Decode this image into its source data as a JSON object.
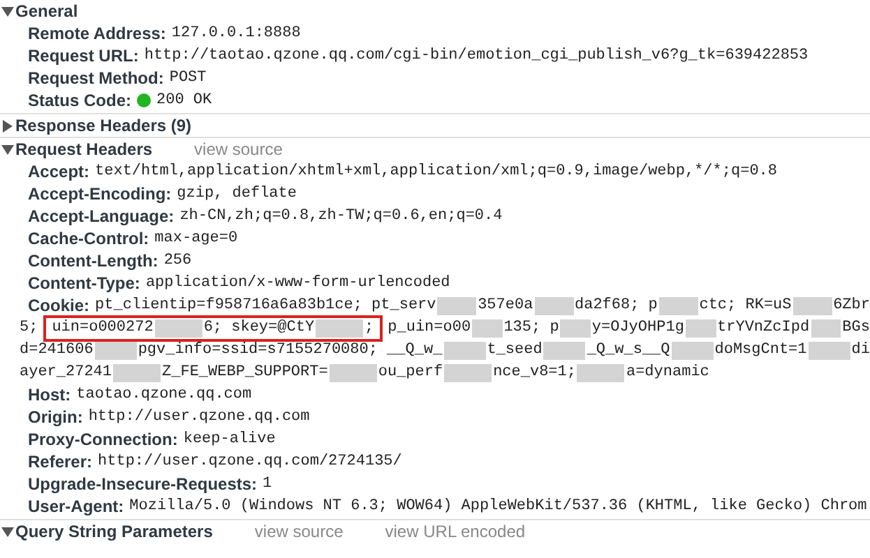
{
  "sections": [
    {
      "title": "General",
      "expanded": true,
      "rows": [
        {
          "kind": "field",
          "name": "Remote Address:",
          "value": "127.0.0.1:8888"
        },
        {
          "kind": "field",
          "name": "Request URL:",
          "value": "http://taotao.qzone.qq.com/cgi-bin/emotion_cgi_publish_v6?g_tk=639422853"
        },
        {
          "kind": "field",
          "name": "Request Method:",
          "value": "POST"
        },
        {
          "kind": "status",
          "name": "Status Code:",
          "value": "200 OK"
        }
      ]
    },
    {
      "title": "Response Headers (9)",
      "expanded": false
    },
    {
      "title": "Request Headers",
      "expanded": true,
      "links": [
        "view source"
      ],
      "rows": [
        {
          "kind": "field",
          "name": "Accept:",
          "value": "text/html,application/xhtml+xml,application/xml;q=0.9,image/webp,*/*;q=0.8"
        },
        {
          "kind": "field",
          "name": "Accept-Encoding:",
          "value": "gzip, deflate"
        },
        {
          "kind": "field",
          "name": "Accept-Language:",
          "value": "zh-CN,zh;q=0.8,zh-TW;q=0.6,en;q=0.4"
        },
        {
          "kind": "field",
          "name": "Cache-Control:",
          "value": "max-age=0"
        },
        {
          "kind": "field",
          "name": "Content-Length:",
          "value": "256"
        },
        {
          "kind": "field",
          "name": "Content-Type:",
          "value": "application/x-www-form-urlencoded"
        },
        {
          "kind": "cookie",
          "name": "Cookie:",
          "lines": [
            [
              {
                "kind": "text",
                "text": "pt_clientip=f958716a6a83b1ce; pt_serv"
              },
              {
                "kind": "blur"
              },
              {
                "kind": "text",
                "text": "357e0a"
              },
              {
                "kind": "blur"
              },
              {
                "kind": "text",
                "text": "da2f68; p"
              },
              {
                "kind": "blur"
              },
              {
                "kind": "text",
                "text": "ctc; RK=uS"
              },
              {
                "kind": "blur"
              },
              {
                "kind": "text",
                "text": "6Zbr"
              }
            ],
            [
              {
                "kind": "text",
                "text": "5;"
              },
              {
                "kind": "boxed",
                "parts": [
                  {
                    "kind": "text",
                    "text": "uin=o000272"
                  },
                  {
                    "kind": "blur"
                  },
                  {
                    "kind": "text",
                    "text": "6; skey=@CtY"
                  },
                  {
                    "kind": "blur"
                  },
                  {
                    "kind": "text",
                    "text": ";"
                  }
                ]
              },
              {
                "kind": "text",
                "text": "p_uin=o00"
              },
              {
                "kind": "blur"
              },
              {
                "kind": "text",
                "text": "135; p"
              },
              {
                "kind": "blur"
              },
              {
                "kind": "text",
                "text": "y=OJyOHP1g"
              },
              {
                "kind": "blur"
              },
              {
                "kind": "text",
                "text": "trYVnZcIpd"
              },
              {
                "kind": "blur"
              },
              {
                "kind": "text",
                "text": "BGs"
              }
            ],
            [
              {
                "kind": "text",
                "text": "d=241606"
              },
              {
                "kind": "blur"
              },
              {
                "kind": "text",
                "text": "pgv_info=ssid=s7155270080; __Q_w_"
              },
              {
                "kind": "blur"
              },
              {
                "kind": "text",
                "text": "t_seed"
              },
              {
                "kind": "blur"
              },
              {
                "kind": "text",
                "text": "_Q_w_s__Q"
              },
              {
                "kind": "blur"
              },
              {
                "kind": "text",
                "text": "doMsgCnt=1"
              },
              {
                "kind": "blur"
              },
              {
                "kind": "text",
                "text": "di"
              }
            ],
            [
              {
                "kind": "text",
                "text": "ayer_27241"
              },
              {
                "kind": "blur"
              },
              {
                "kind": "text",
                "text": "Z_FE_WEBP_SUPPORT="
              },
              {
                "kind": "blur"
              },
              {
                "kind": "text",
                "text": "ou_perf"
              },
              {
                "kind": "blur"
              },
              {
                "kind": "text",
                "text": "nce_v8=1;"
              },
              {
                "kind": "blur"
              },
              {
                "kind": "text",
                "text": "a=dynamic"
              }
            ]
          ]
        },
        {
          "kind": "field",
          "name": "Host:",
          "value": "taotao.qzone.qq.com"
        },
        {
          "kind": "field",
          "name": "Origin:",
          "value": "http://user.qzone.qq.com"
        },
        {
          "kind": "field",
          "name": "Proxy-Connection:",
          "value": "keep-alive"
        },
        {
          "kind": "field",
          "name": "Referer:",
          "value": "http://user.qzone.qq.com/2724135/"
        },
        {
          "kind": "field",
          "name": "Upgrade-Insecure-Requests:",
          "value": "1"
        },
        {
          "kind": "field",
          "name": "User-Agent:",
          "value": "Mozilla/5.0 (Windows NT 6.3; WOW64) AppleWebKit/537.36 (KHTML, like Gecko) Chrom"
        }
      ]
    },
    {
      "title": "Query String Parameters",
      "expanded": true,
      "links": [
        "view source",
        "view URL encoded"
      ]
    }
  ]
}
